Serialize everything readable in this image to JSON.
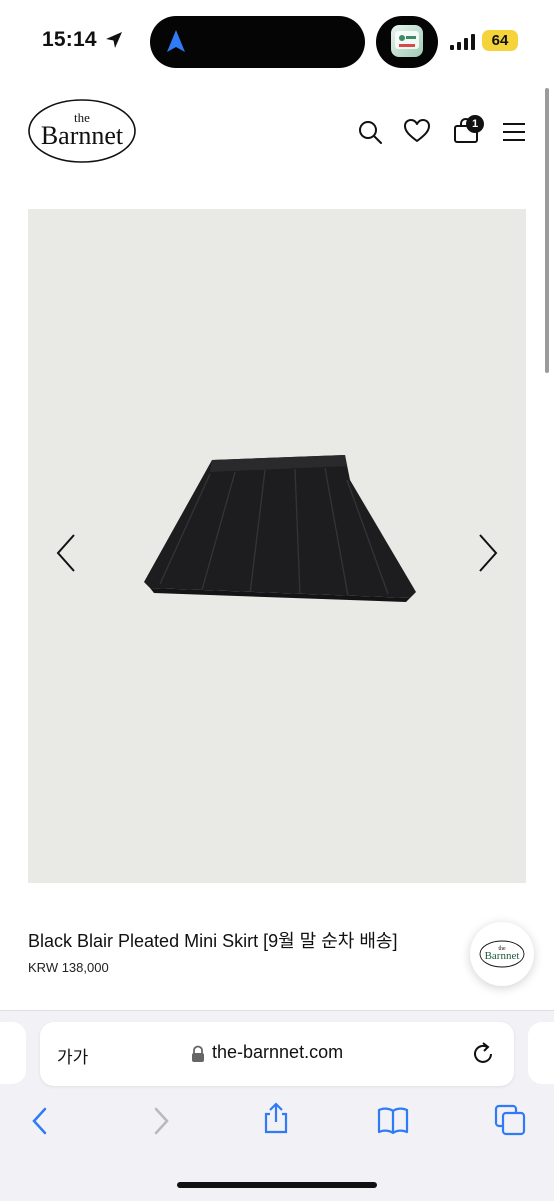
{
  "status_bar": {
    "time": "15:14",
    "battery": "64"
  },
  "header": {
    "logo_the": "the",
    "logo_name": "Barnnet",
    "cart_count": "1"
  },
  "product": {
    "title": "Black Blair Pleated Mini Skirt [9월 말 순차 배송]",
    "price": "KRW 138,000"
  },
  "chat": {
    "logo_the": "the",
    "logo_name": "Barnnet"
  },
  "browser": {
    "text_size_label": "가가",
    "url": "the-barnnet.com"
  },
  "colors": {
    "image_bg": "#e9e9e5",
    "accent_blue": "#2f7bf6",
    "battery_yellow": "#f4d33b"
  }
}
